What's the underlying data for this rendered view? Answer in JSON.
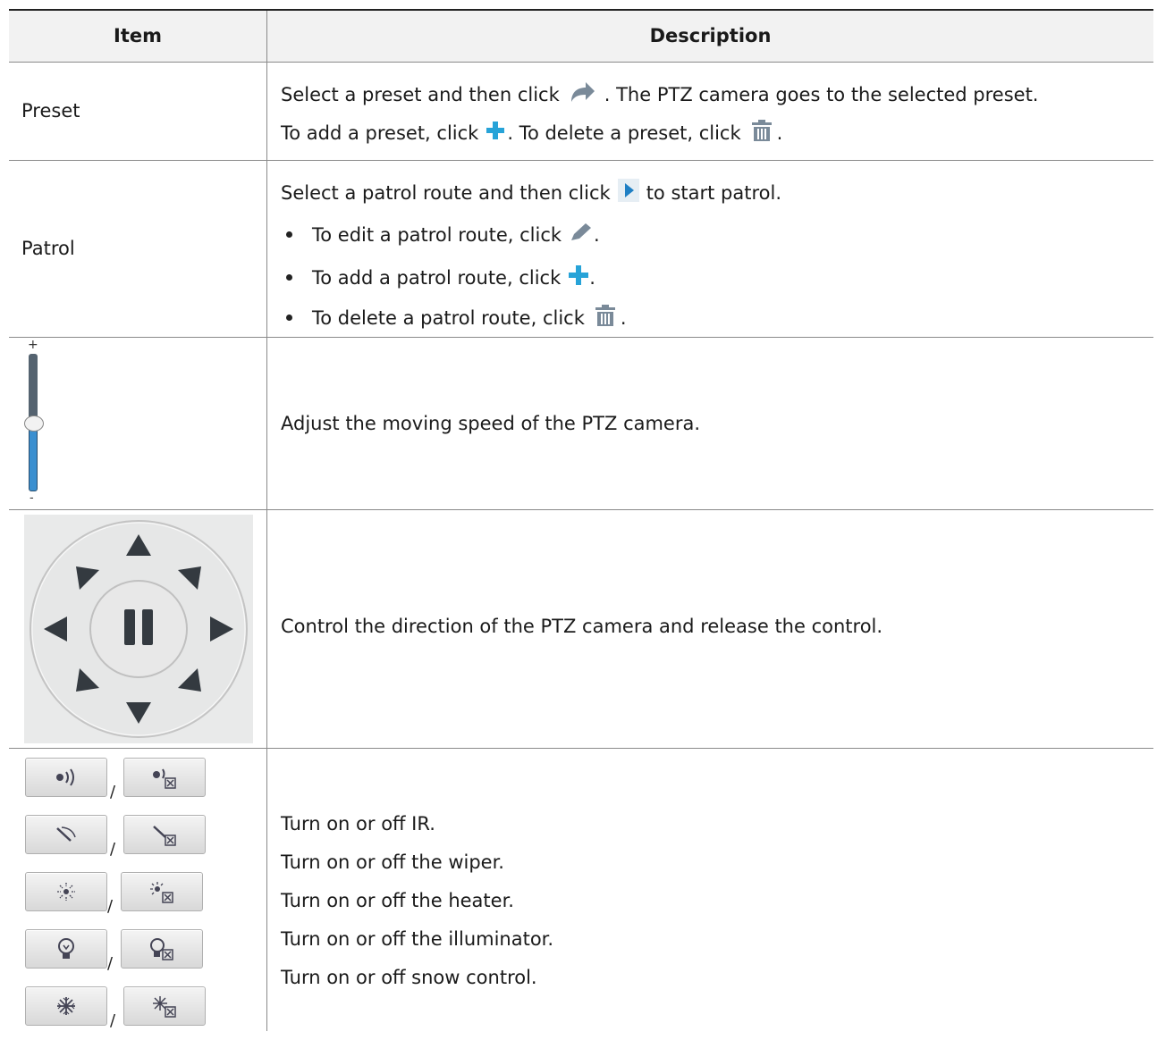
{
  "header": {
    "item": "Item",
    "description": "Description"
  },
  "rows": {
    "preset": {
      "item": "Preset",
      "line1_a": "Select a preset and then click",
      "line1_b": ". The PTZ camera goes to the selected preset.",
      "line2_a": "To add a preset, click",
      "line2_b": ". To delete a preset, click",
      "line2_c": "."
    },
    "patrol": {
      "item": "Patrol",
      "line1_a": "Select a patrol route and then click",
      "line1_b": "to start patrol.",
      "b1_a": "To edit a patrol route, click",
      "b1_b": ".",
      "b2_a": "To add a patrol route, click",
      "b2_b": ".",
      "b3_a": "To delete a patrol route, click",
      "b3_b": "."
    },
    "speed": {
      "plus": "+",
      "minus": "-",
      "description": "Adjust the moving speed of the PTZ camera."
    },
    "direction": {
      "description": "Control the direction of the PTZ camera and release the control."
    },
    "toggles": {
      "slash": "/",
      "lines": [
        "Turn on or off IR.",
        "Turn on or off the wiper.",
        "Turn on or off the heater.",
        "Turn on or off the illuminator.",
        "Turn on or off snow control."
      ]
    }
  },
  "icons": {
    "goto": "goto-preset-icon",
    "add": "add-icon",
    "delete": "delete-icon",
    "play": "start-patrol-icon",
    "edit": "edit-icon"
  },
  "colors": {
    "accent_blue": "#27a3d8",
    "icon_gray": "#7a8a99",
    "slider_blue": "#3a8fd0"
  }
}
